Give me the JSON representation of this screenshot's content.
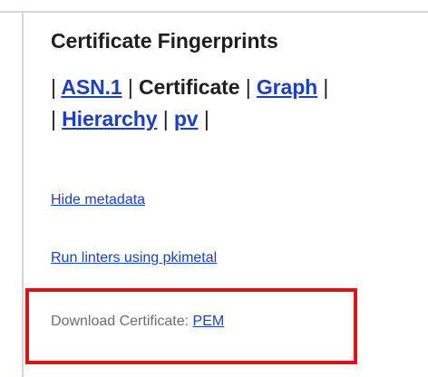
{
  "section": {
    "title": "Certificate Fingerprints"
  },
  "nav": {
    "sep": "|",
    "asn1": "ASN.1",
    "certificate": "Certificate",
    "graph": "Graph",
    "hierarchy": "Hierarchy",
    "pv": "pv"
  },
  "links": {
    "hide_metadata": "Hide metadata",
    "run_linters": "Run linters using pkimetal"
  },
  "download": {
    "label": "Download Certificate:",
    "pem": "PEM"
  },
  "colors": {
    "link": "#1f3fbf",
    "text": "#1f1f1f",
    "muted": "#6d6d6d",
    "highlight": "#d9141b"
  }
}
